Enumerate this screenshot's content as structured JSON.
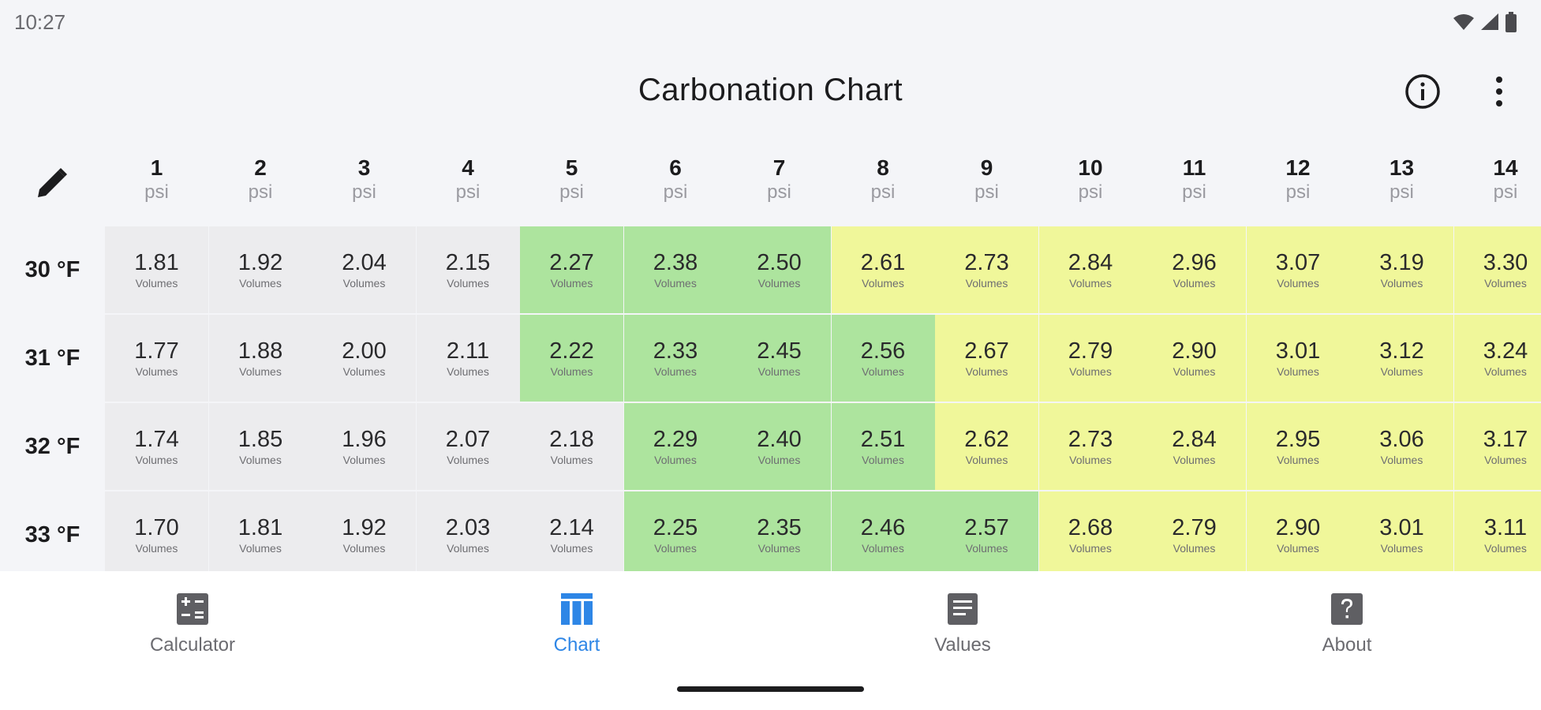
{
  "status": {
    "time": "10:27"
  },
  "app_bar": {
    "title": "Carbonation Chart"
  },
  "header": {
    "psi": [
      {
        "num": "1",
        "unit": "psi"
      },
      {
        "num": "2",
        "unit": "psi"
      },
      {
        "num": "3",
        "unit": "psi"
      },
      {
        "num": "4",
        "unit": "psi"
      },
      {
        "num": "5",
        "unit": "psi"
      },
      {
        "num": "6",
        "unit": "psi"
      },
      {
        "num": "7",
        "unit": "psi"
      },
      {
        "num": "8",
        "unit": "psi"
      },
      {
        "num": "9",
        "unit": "psi"
      },
      {
        "num": "10",
        "unit": "psi"
      },
      {
        "num": "11",
        "unit": "psi"
      },
      {
        "num": "12",
        "unit": "psi"
      },
      {
        "num": "13",
        "unit": "psi"
      },
      {
        "num": "14",
        "unit": "psi"
      }
    ]
  },
  "colors": {
    "gray": "#ececee",
    "green": "#ade49e",
    "yellow": "#f0f79a",
    "accent": "#2e86e6"
  },
  "cell_unit": "Volumes",
  "rows": [
    {
      "label": "30 °F",
      "values": [
        "1.81",
        "1.92",
        "2.04",
        "2.15",
        "2.27",
        "2.38",
        "2.50",
        "2.61",
        "2.73",
        "2.84",
        "2.96",
        "3.07",
        "3.19",
        "3.30"
      ],
      "zones": [
        "gray",
        "gray",
        "gray",
        "gray",
        "green",
        "green",
        "green",
        "yellow",
        "yellow",
        "yellow",
        "yellow",
        "yellow",
        "yellow",
        "yellow"
      ]
    },
    {
      "label": "31 °F",
      "values": [
        "1.77",
        "1.88",
        "2.00",
        "2.11",
        "2.22",
        "2.33",
        "2.45",
        "2.56",
        "2.67",
        "2.79",
        "2.90",
        "3.01",
        "3.12",
        "3.24"
      ],
      "zones": [
        "gray",
        "gray",
        "gray",
        "gray",
        "green",
        "green",
        "green",
        "green",
        "yellow",
        "yellow",
        "yellow",
        "yellow",
        "yellow",
        "yellow"
      ]
    },
    {
      "label": "32 °F",
      "values": [
        "1.74",
        "1.85",
        "1.96",
        "2.07",
        "2.18",
        "2.29",
        "2.40",
        "2.51",
        "2.62",
        "2.73",
        "2.84",
        "2.95",
        "3.06",
        "3.17"
      ],
      "zones": [
        "gray",
        "gray",
        "gray",
        "gray",
        "gray",
        "green",
        "green",
        "green",
        "yellow",
        "yellow",
        "yellow",
        "yellow",
        "yellow",
        "yellow"
      ]
    },
    {
      "label": "33 °F",
      "values": [
        "1.70",
        "1.81",
        "1.92",
        "2.03",
        "2.14",
        "2.25",
        "2.35",
        "2.46",
        "2.57",
        "2.68",
        "2.79",
        "2.90",
        "3.01",
        "3.11"
      ],
      "zones": [
        "gray",
        "gray",
        "gray",
        "gray",
        "gray",
        "green",
        "green",
        "green",
        "green",
        "yellow",
        "yellow",
        "yellow",
        "yellow",
        "yellow"
      ]
    }
  ],
  "nav": {
    "items": [
      {
        "label": "Calculator",
        "icon": "calculator-icon"
      },
      {
        "label": "Chart",
        "icon": "chart-icon",
        "active": true
      },
      {
        "label": "Values",
        "icon": "values-icon"
      },
      {
        "label": "About",
        "icon": "about-icon"
      }
    ]
  }
}
